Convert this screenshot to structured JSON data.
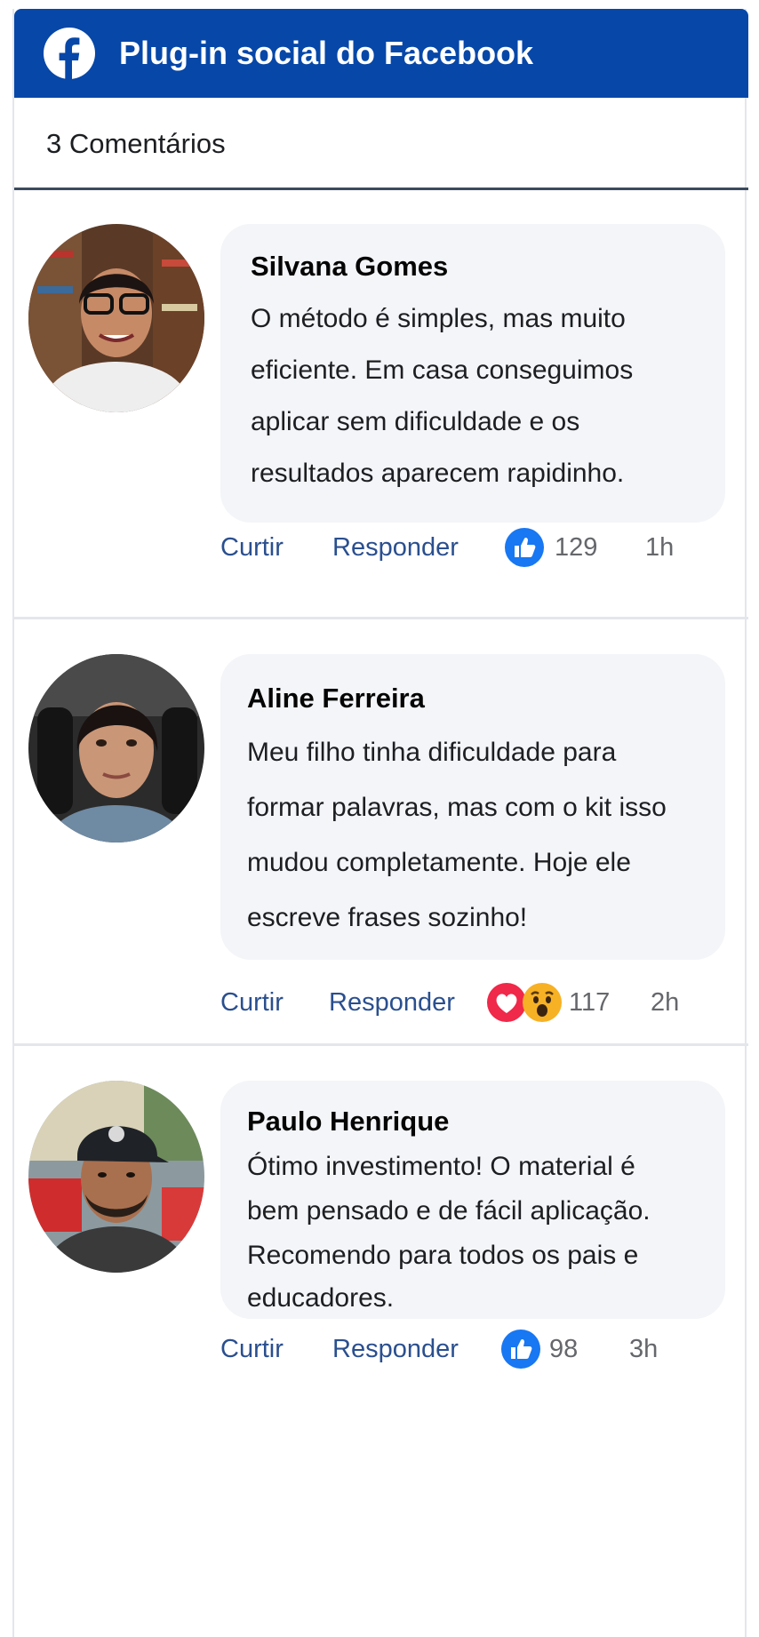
{
  "header": {
    "title": "Plug-in social do Facebook",
    "brand_color": "#0647a8",
    "logo_icon": "facebook-logo-icon"
  },
  "comments_count": "3 Comentários",
  "comments": [
    {
      "author": "Silvana Gomes",
      "text_lines": [
        "O método é simples, mas muito",
        "eficiente. Em casa conseguimos",
        "aplicar sem dificuldade e os",
        "resultados aparecem rapidinho."
      ],
      "like_label": "Curtir",
      "reply_label": "Responder",
      "reactions": [
        "like-icon"
      ],
      "reaction_count": "129",
      "time": "1h"
    },
    {
      "author": "Aline Ferreira",
      "text_lines": [
        "Meu filho tinha dificuldade para",
        "formar palavras, mas com o kit isso",
        "mudou completamente. Hoje ele",
        "escreve frases sozinho!"
      ],
      "like_label": "Curtir",
      "reply_label": "Responder",
      "reactions": [
        "love-icon",
        "wow-icon"
      ],
      "reaction_count": "117",
      "time": "2h"
    },
    {
      "author": "Paulo Henrique",
      "text_lines": [
        "Ótimo investimento! O material é",
        "bem pensado e de fácil aplicação.",
        "Recomendo para todos os pais e",
        "educadores."
      ],
      "like_label": "Curtir",
      "reply_label": "Responder",
      "reactions": [
        "like-icon"
      ],
      "reaction_count": "98",
      "time": "3h"
    }
  ]
}
